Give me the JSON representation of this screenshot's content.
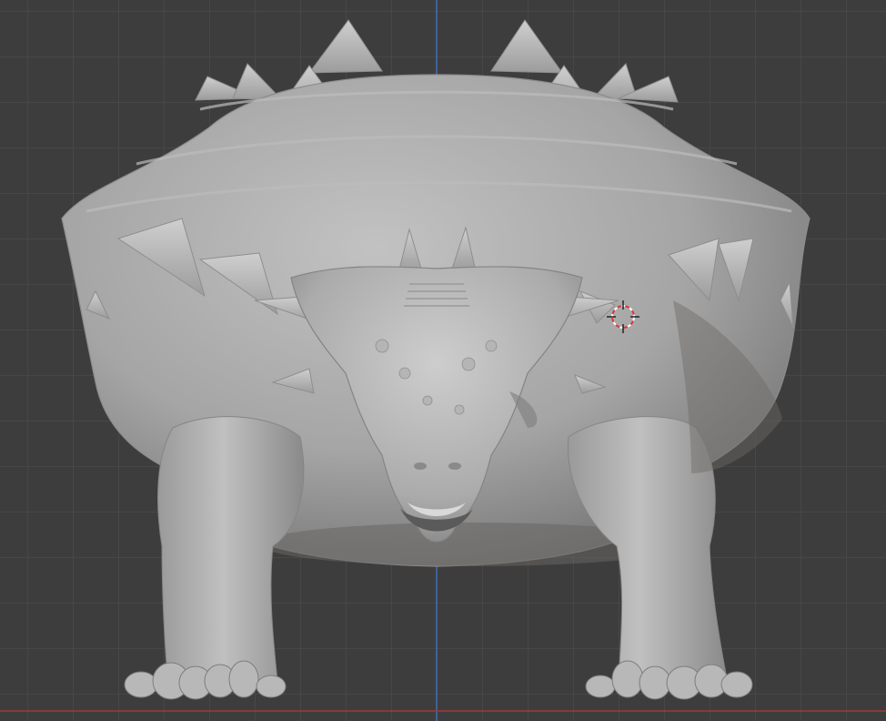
{
  "viewport": {
    "view": "front-orthographic",
    "shading": "solid",
    "object": "ankylosaur-sculpt",
    "background_color": "#3d3d3d",
    "grid_color": "#474747",
    "z_axis_color": "#3f6fb4",
    "x_axis_color": "#a23a3a",
    "mesh_color": "#a7a7a7",
    "cursor_color": "#d83a3a"
  }
}
